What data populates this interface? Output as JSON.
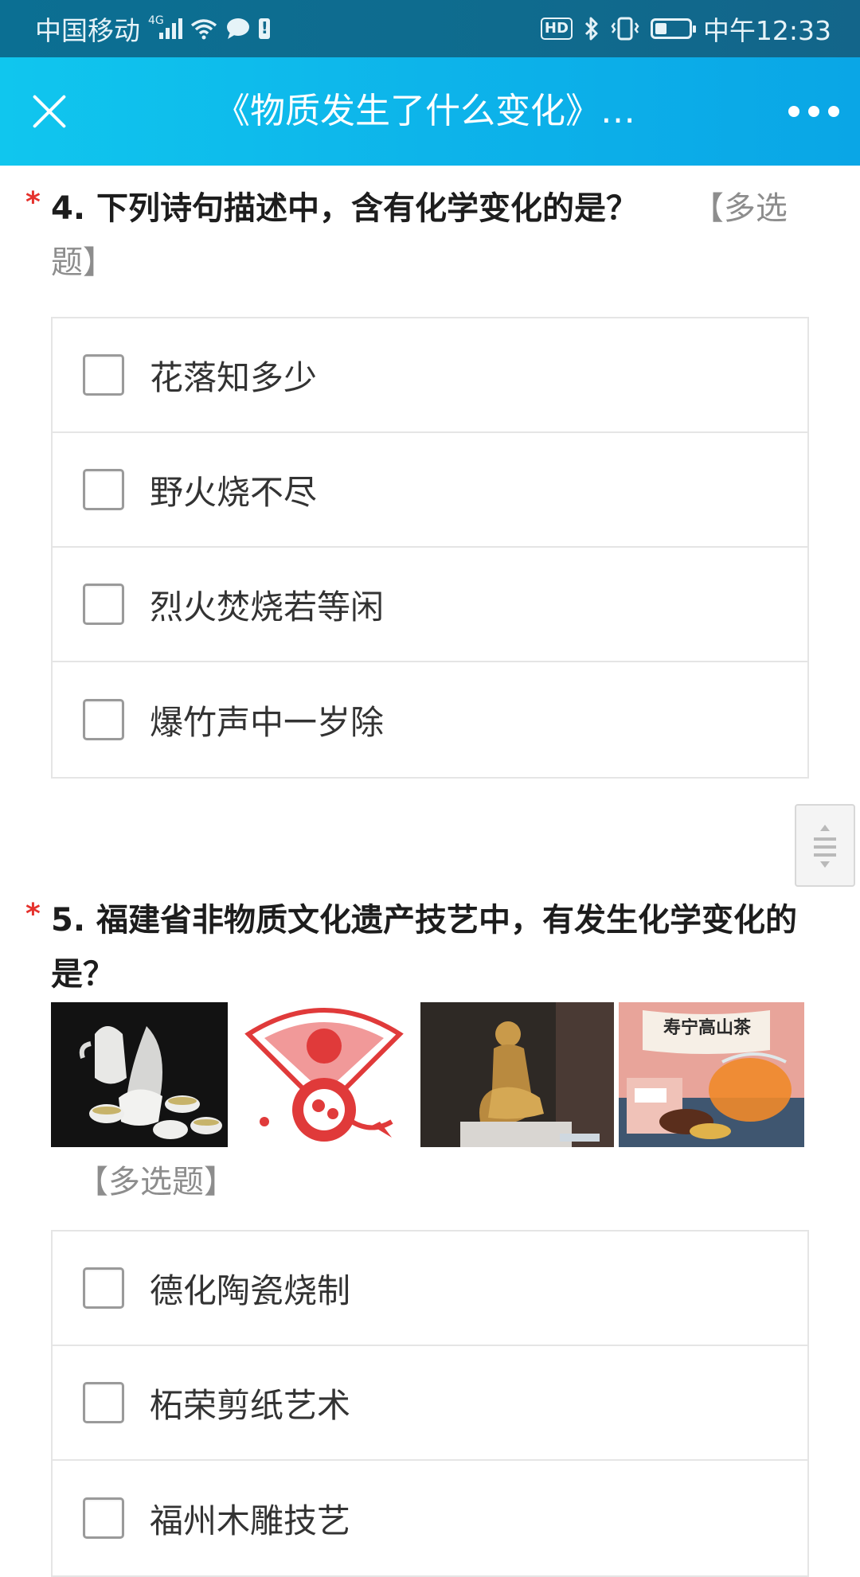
{
  "status_bar": {
    "carrier": "中国移动",
    "network": "4G",
    "time": "中午12:33",
    "hd_label": "HD",
    "icons": [
      "signal-icon",
      "wifi-icon",
      "chat-bubble-icon",
      "battery-alert-icon",
      "bluetooth-icon",
      "vibrate-icon",
      "battery-icon"
    ],
    "battery_level": 0.35
  },
  "title_bar": {
    "title": "《物质发生了什么变化》…",
    "close_icon": "close-icon",
    "more_icon": "more-icon"
  },
  "questions": [
    {
      "required_mark": "*",
      "text": "4. 下列诗句描述中，含有化学变化的是？",
      "tag": "【多选题】",
      "options": [
        "花落知多少",
        "野火烧不尽",
        "烈火焚烧若等闲",
        "爆竹声中一岁除"
      ]
    },
    {
      "required_mark": "*",
      "text": "5. 福建省非物质文化遗产技艺中，有发生化学变化的是？",
      "tag": "【多选题】",
      "images": [
        "dehua-porcelain-image",
        "papercut-image",
        "wood-carving-image",
        "tea-image"
      ],
      "image_caption": "寿宁高山茶",
      "options": [
        "德化陶瓷烧制",
        "柘荣剪纸艺术",
        "福州木雕技艺"
      ]
    }
  ],
  "colors": {
    "status_bar": "#0f6b8e",
    "title_bar": "#0db4ea",
    "required": "#e5322d",
    "tag": "#8d8d8d"
  }
}
